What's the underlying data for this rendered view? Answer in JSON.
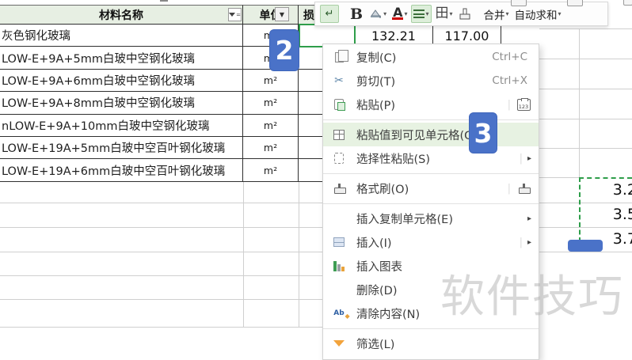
{
  "colors": {
    "accent_green": "#2e9e4a",
    "badge_blue": "#4a72c8",
    "header_green": "#e7efe3",
    "menu_highlight": "#e7f2e2"
  },
  "sheet": {
    "headers": {
      "name": "材料名称",
      "unit": "单位",
      "loss": "损"
    },
    "rows": [
      {
        "name": "灰色钢化玻璃",
        "unit": "m²"
      },
      {
        "name": "LOW-E+9A+5mm白玻中空钢化玻璃",
        "unit": "m²"
      },
      {
        "name": "LOW-E+9A+6mm白玻中空钢化玻璃",
        "unit": "m²"
      },
      {
        "name": "LOW-E+9A+8mm白玻中空钢化玻璃",
        "unit": "m²"
      },
      {
        "name": "nLOW-E+9A+10mm白玻中空钢化玻璃",
        "unit": "m²"
      },
      {
        "name": "LOW-E+19A+5mm白玻中空百叶钢化玻璃",
        "unit": "m²"
      },
      {
        "name": "LOW-E+19A+6mm白玻中空百叶钢化玻璃",
        "unit": "m²"
      }
    ],
    "row1_values": [
      "132.21",
      "117.00"
    ],
    "right_values": [
      "3.2",
      "3.5",
      "3.7"
    ]
  },
  "toolbar": {
    "wrap_icon": "↵",
    "bold_label": "B",
    "font_color_label": "A",
    "border_label": "田",
    "merge_label": "合并",
    "autosum_label": "自动求和",
    "caret": "▾"
  },
  "menu": {
    "items": [
      {
        "left_icon": "copy-icon",
        "label": "复制(C)",
        "shortcut": "Ctrl+C"
      },
      {
        "left_icon": "cut-icon",
        "label": "剪切(T)",
        "shortcut": "Ctrl+X"
      },
      {
        "left_icon": "paste-icon",
        "label": "粘贴(P)",
        "right_icon": "paste-123-icon",
        "right_sep": true,
        "separator_after": true
      },
      {
        "left_icon": "paste-values-visible-icon",
        "label": "粘贴值到可见单元格(G)",
        "highlighted": true
      },
      {
        "left_icon": "paste-special-icon",
        "label": "选择性粘贴(S)",
        "submenu": true,
        "right_sep": true,
        "separator_after": true
      },
      {
        "left_icon": "format-painter-icon",
        "label": "格式刷(O)",
        "right_icon": "brush-icon",
        "right_sep": true,
        "separator_after": true
      },
      {
        "label": "插入复制单元格(E)",
        "submenu": true
      },
      {
        "left_icon": "insert-cells-icon",
        "label": "插入(I)",
        "submenu": true,
        "right_sep": true
      },
      {
        "left_icon": "insert-chart-icon",
        "label": "插入图表"
      },
      {
        "label": "删除(D)"
      },
      {
        "left_icon": "clear-contents-icon",
        "label": "清除内容(N)",
        "separator_after": true
      },
      {
        "left_icon": "filter-icon",
        "label": "筛选(L)"
      }
    ]
  },
  "badges": {
    "step2": "2",
    "step3": "3"
  },
  "watermark": "软件技巧"
}
